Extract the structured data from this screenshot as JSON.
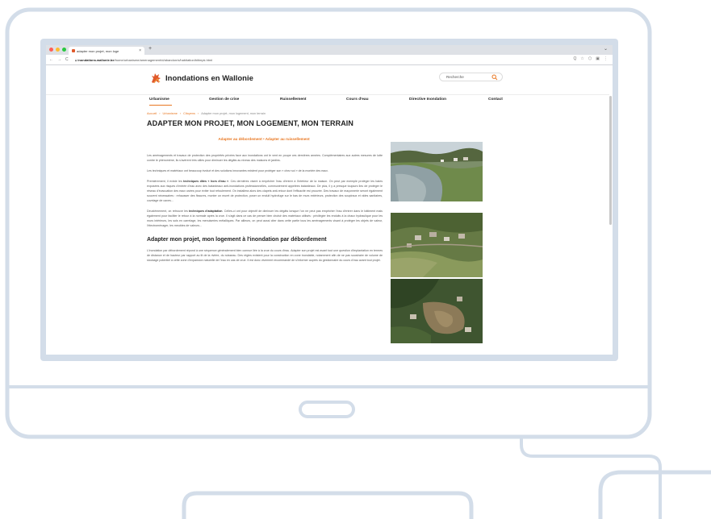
{
  "browser": {
    "tab_title": "adapter mon projet, mon loge",
    "url_domain": "inondations.wallonie.be",
    "url_path": "/home/urbanisme/amenagement/d/abandon/s/habitation/bitimpk.html",
    "nav_back": "←",
    "nav_forward": "→",
    "nav_reload": "C",
    "new_tab": "+",
    "tab_close": "×",
    "window_control": "⌄",
    "extensions": [
      "Q",
      "☆",
      "⬡",
      "▣",
      "⋮"
    ],
    "colors": {
      "red": "#ff5f57",
      "yellow": "#febc2e",
      "green": "#28c840"
    }
  },
  "site": {
    "brand": "Inondations en Wallonie",
    "brand_color": "#e05a2b",
    "accent": "#e87722",
    "search_placeholder": "Recherche",
    "menu": [
      {
        "label": "Urbanisme",
        "active": true
      },
      {
        "label": "Gestion de crise"
      },
      {
        "label": "Ruissellement"
      },
      {
        "label": "Cours d'eau"
      },
      {
        "label": "Directive Inondation"
      },
      {
        "label": "Contact"
      }
    ],
    "breadcrumb": [
      "Accueil",
      "Urbanisme",
      "Citoyens",
      "Adapter mon projet, mon logement, mon terrain"
    ],
    "page_title": "ADAPTER MON PROJET, MON LOGEMENT, MON TERRAIN",
    "subnav_1": "Adapter au débordement",
    "subnav_sep": " • ",
    "subnav_2": "Adapter au ruissellement",
    "p1": "Les aménagements et travaux de protection des propriétés privées face aux inondations ont le vent en poupe ces dernières années. Complémentaires aux autres mesures de lutte contre le phénomène, ils s'avèrent très utiles pour diminuer les dégâts au niveau des maisons et jardins.",
    "p2": "Les techniques et matériaux ont beaucoup évolué et des solutions innovantes existent pour protéger son « chez soi » de la montée des eaux.",
    "p3_a": "Premièrement, il existe les ",
    "p3_b": "techniques dites « hors d'eau »",
    "p3_c": ". Ces dernières visent à empêcher l'eau d'entrer à l'intérieur de la maison. On peut par exemple protéger les baies exposées aux risques d'entrée d'eau avec des batardeaux anti-inondations professionnelles, communément appelées batardeaux. De plus, il y a presque toujours lieu de protéger le réseau d'évacuation des eaux usées pour éviter tout refoulement. On installera alors des clapets anti-retour dont l'efficacité est prouvée. Des travaux de maçonnerie seront également souvent nécessaires : rehausser des fissures, monter un muret de protection, poser un enduit hydrofuge sur le bas de murs extérieurs, protection des soupiraux et vides sanitaires, cuvelage de caves...",
    "p4_a": "Deuxièmement, on retrouve les ",
    "p4_b": "techniques d'adaptation",
    "p4_c": ". Celles-ci ont pour objectif de diminuer les dégâts lorsque l'on ne peut pas empêcher l'eau d'entrer dans le bâtiment mais également pour faciliter le retour à la normale après la crue. Il s'agit dans ce cas de penser bien choisir des matériaux utilisés : privilégier les enduits à la chaux hydraulique pour les murs intérieurs, les sols en carrelage, les menuiseries métalliques. Par ailleurs, on peut aussi citer dans cette partie tous les aménagements visant à protéger les objets de valeur, l'électroménager, les meubles de valeurs...",
    "h2": "Adapter mon projet, mon logement à l'inondation par débordement",
    "p5": "L'inondation par débordement répond à une séquence généralement bien connue liée à la crue du cours d'eau. Adapter son projet est avant tout une question d'implantation en termes de distance et de hauteur par rapport au lit de la rivière, du ruisseau. Des règles existent pour la construction en zone inondable, notamment afin de ne pas soustraire de volume de stockage potentiel à cette zone d'expansion naturelle de l'eau en cas de crue. Il est donc vivement recommandé de s'informer auprès du gestionnaire du cours d'eau avant tout projet."
  },
  "illustration": {
    "frame_color": "#d3dde9",
    "stroke_color": "#c9d5e3"
  }
}
